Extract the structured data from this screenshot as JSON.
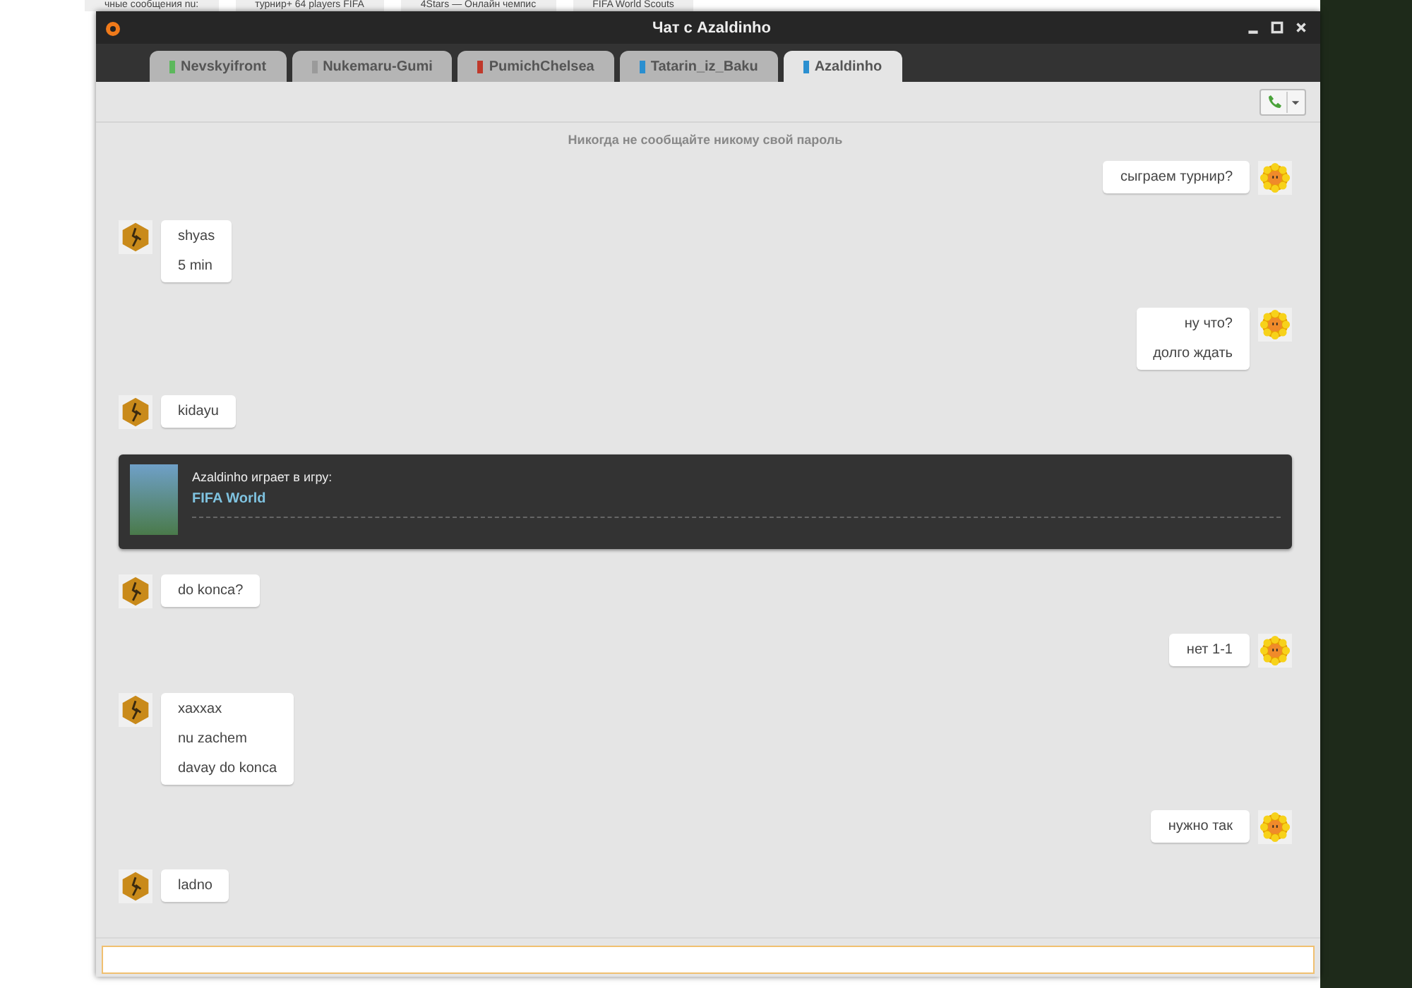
{
  "background_tabs": [
    {
      "label": "чные сообщения nu:"
    },
    {
      "label": "турнир+ 64 players FIFA"
    },
    {
      "label": "4Stars — Онлайн чемпис"
    },
    {
      "label": "FIFA World Scouts"
    }
  ],
  "window": {
    "title": "Чат с Azaldinho"
  },
  "tabs": [
    {
      "label": "Nevskyifront",
      "color": "#5cb85c",
      "selected": false
    },
    {
      "label": "Nukemaru-Gumi",
      "color": "#9a9a9a",
      "selected": false
    },
    {
      "label": "PumichChelsea",
      "color": "#c0392b",
      "selected": false
    },
    {
      "label": "Tatarin_iz_Baku",
      "color": "#2a8fd0",
      "selected": false
    },
    {
      "label": "Azaldinho",
      "color": "#2a8fd0",
      "selected": true
    }
  ],
  "notice": "Никогда не сообщайте никому свой пароль",
  "messages": [
    {
      "kind": "sent",
      "lines": [
        "сыграем турнир?"
      ]
    },
    {
      "kind": "received",
      "lines": [
        "shyas",
        "5 min"
      ]
    },
    {
      "kind": "sent",
      "lines": [
        "ну что?",
        "долго ждать"
      ]
    },
    {
      "kind": "received",
      "lines": [
        "kidayu"
      ]
    },
    {
      "kind": "game",
      "status": "Azaldinho играет в игру:",
      "game": "FIFA World"
    },
    {
      "kind": "received",
      "lines": [
        "do konca?"
      ]
    },
    {
      "kind": "sent",
      "lines": [
        "нет 1-1"
      ]
    },
    {
      "kind": "received",
      "lines": [
        "xaxxax",
        "nu zachem",
        "davay do konca"
      ]
    },
    {
      "kind": "sent",
      "lines": [
        "нужно так"
      ]
    },
    {
      "kind": "received",
      "lines": [
        "ladno"
      ]
    }
  ]
}
